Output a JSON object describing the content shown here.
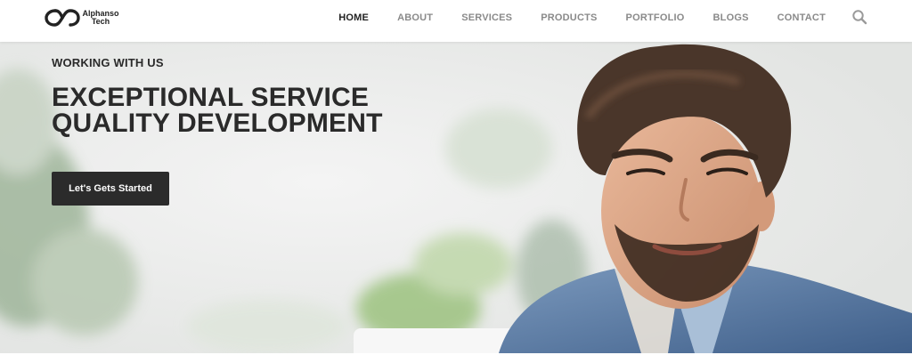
{
  "brand": {
    "line1": "Alphanso",
    "line2": "Tech"
  },
  "nav": {
    "items": [
      {
        "label": "HOME",
        "active": true
      },
      {
        "label": "ABOUT",
        "active": false
      },
      {
        "label": "SERVICES",
        "active": false
      },
      {
        "label": "PRODUCTS",
        "active": false
      },
      {
        "label": "PORTFOLIO",
        "active": false
      },
      {
        "label": "BLOGS",
        "active": false
      },
      {
        "label": "CONTACT",
        "active": false
      }
    ],
    "search_icon": "search-icon"
  },
  "hero": {
    "eyebrow": "WORKING WITH US",
    "headline_line1": "EXCEPTIONAL SERVICE",
    "headline_line2": "QUALITY DEVELOPMENT",
    "cta_label": "Let's Gets Started"
  },
  "colors": {
    "text_dark": "#2a2a2a",
    "nav_inactive": "#8a8a8a",
    "button_bg": "#2b2b2b"
  }
}
